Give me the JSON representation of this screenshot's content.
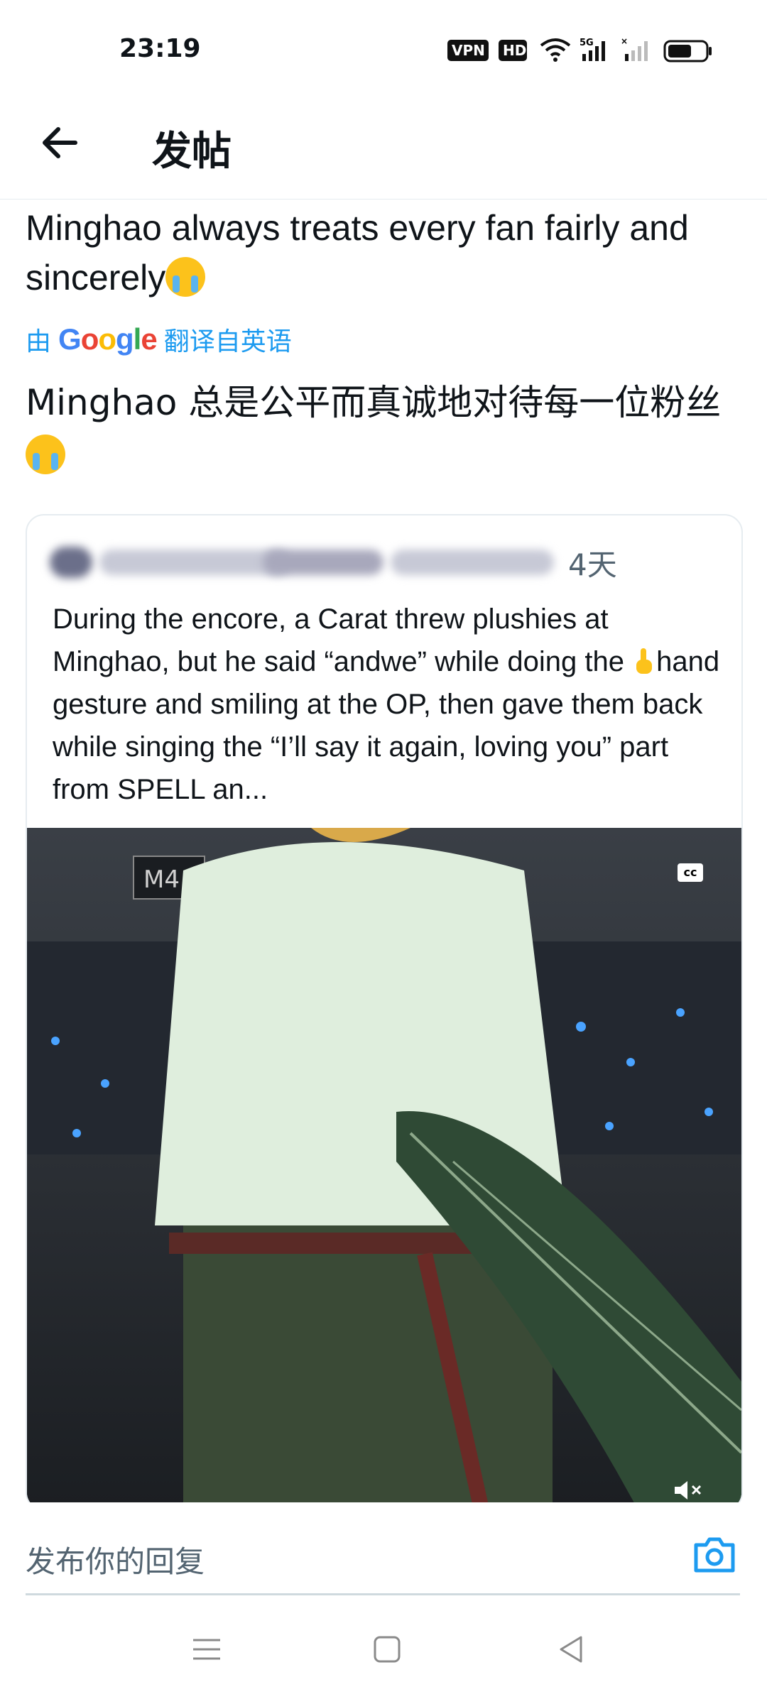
{
  "status_bar": {
    "time": "23:19",
    "badges": [
      "VPN",
      "HD"
    ],
    "network": "5G",
    "icons": [
      "vpn-icon",
      "hd-icon",
      "wifi-icon",
      "signal-icon",
      "battery-icon"
    ]
  },
  "header": {
    "back_icon": "arrow-left-icon",
    "title": "发帖"
  },
  "post": {
    "text": "Minghao always treats every fan fairly and sincerely",
    "translation_prefix": "由",
    "translation_brand": "Google",
    "translation_suffix": "翻译自英语",
    "translated_text": "Minghao 总是公平而真诚地对待每一位粉丝"
  },
  "quote": {
    "time": "4天",
    "text_part1": "During the encore, a Carat threw plushies at Minghao, but he said “andwe” while doing the ",
    "text_part2": "hand gesture and smiling at the OP, then gave them back while singing the “I’ll say it again, loving you” part from SPELL an...",
    "media_cc": "cc"
  },
  "reply": {
    "placeholder": "发布你的回复"
  },
  "colors": {
    "accent": "#1d9bf0",
    "text": "#0f1419",
    "muted": "#536471"
  }
}
